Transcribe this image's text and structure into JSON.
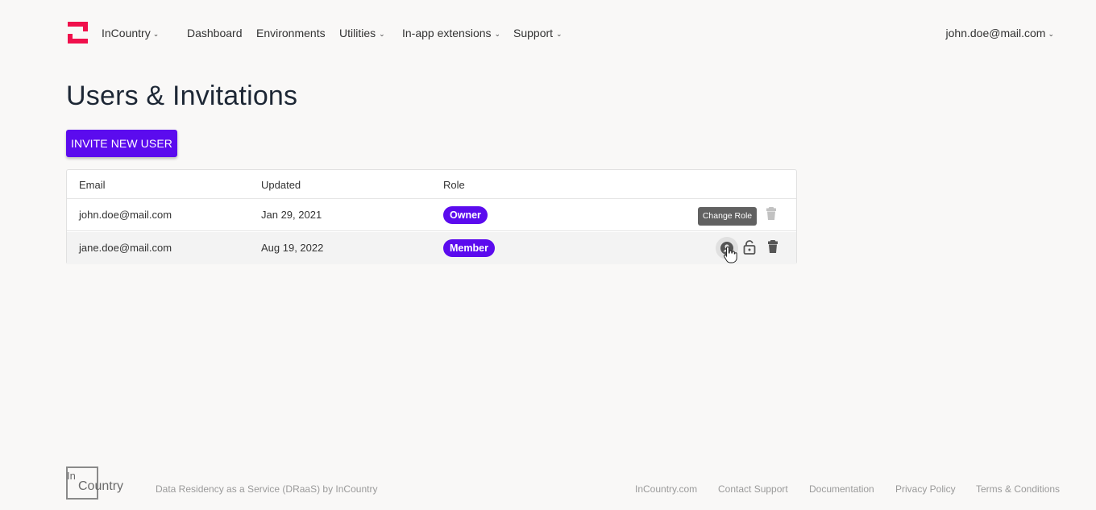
{
  "header": {
    "org": "InCountry",
    "nav": [
      {
        "label": "Dashboard",
        "dropdown": false
      },
      {
        "label": "Environments",
        "dropdown": false
      },
      {
        "label": "Utilities",
        "dropdown": true
      },
      {
        "label": "In-app extensions",
        "dropdown": true
      },
      {
        "label": "Support",
        "dropdown": true
      }
    ],
    "user_email": "john.doe@mail.com"
  },
  "page": {
    "title": "Users & Invitations",
    "invite_label": "Invite new user"
  },
  "table": {
    "columns": [
      "Email",
      "Updated",
      "Role"
    ],
    "rows": [
      {
        "email": "john.doe@mail.com",
        "updated": "Jan 29, 2021",
        "role": "Owner"
      },
      {
        "email": "jane.doe@mail.com",
        "updated": "Aug 19, 2022",
        "role": "Member"
      }
    ]
  },
  "tooltip": "Change Role",
  "footer": {
    "logo_text_top": "In",
    "logo_text_bottom": "Country",
    "tagline": "Data Residency as a Service (DRaaS) by InCountry",
    "links": [
      "InCountry.com",
      "Contact Support",
      "Documentation",
      "Privacy Policy",
      "Terms & Conditions"
    ]
  },
  "colors": {
    "brand": "#f0104c",
    "accent": "#5b0bee",
    "background": "#f9f8f7"
  }
}
